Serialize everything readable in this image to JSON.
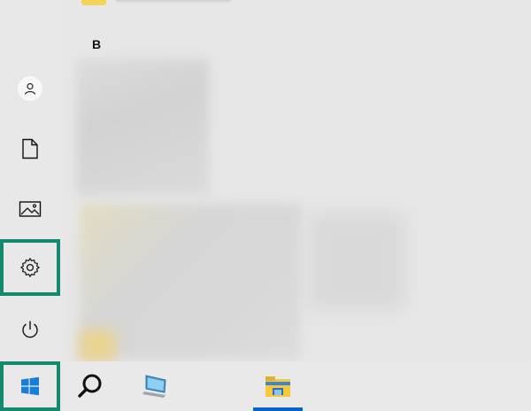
{
  "start_menu": {
    "group_letter": "B"
  },
  "rail": {
    "items": [
      {
        "name": "user-account",
        "icon": "user-icon"
      },
      {
        "name": "documents",
        "icon": "document-icon"
      },
      {
        "name": "pictures",
        "icon": "pictures-icon"
      },
      {
        "name": "settings",
        "icon": "gear-icon",
        "highlighted": true
      },
      {
        "name": "power",
        "icon": "power-icon"
      }
    ]
  },
  "taskbar": {
    "items": [
      {
        "name": "start",
        "icon": "windows-logo-icon",
        "highlighted": true
      },
      {
        "name": "search",
        "icon": "search-icon"
      },
      {
        "name": "this-pc",
        "icon": "computer-icon"
      },
      {
        "name": "file-explorer",
        "icon": "folder-icon",
        "active": true
      }
    ]
  },
  "colors": {
    "highlight": "#138a6e",
    "active_indicator": "#0a64c8",
    "windows_logo": "#1a7fd4"
  }
}
